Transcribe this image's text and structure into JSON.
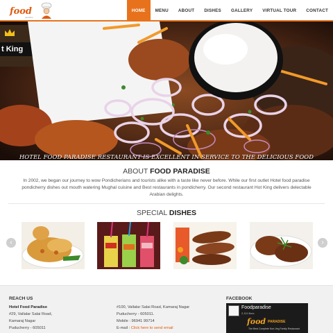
{
  "header": {
    "logo_text": "food",
    "logo_sub": "paradise",
    "nav": [
      "HOME",
      "MENU",
      "ABOUT",
      "DISHES",
      "GALLERY",
      "VIRTUAL TOUR",
      "CONTACT"
    ],
    "active_index": 0
  },
  "hero": {
    "sign_text": "t King",
    "caption": "HOTEL FOOD PARADISE RESTAURANT IS EXCELLENT IN SERVICE TO THE DELICIOUS FOOD"
  },
  "about": {
    "title_prefix": "ABOUT ",
    "title_bold": "FOOD PARADISE",
    "text": "In 2002, we began our journey to wow Pondicherians and tourists alike with a taste like never before. While our first outlet Hotel food paradise pondicherry dishes out mouth watering Mughal cuisine and Best restaurants in pondicherry. Our second restaurant Hot King delivers delectable Arabian delights."
  },
  "special": {
    "title_prefix": "SPECIAL ",
    "title_bold": "DISHES",
    "prev_icon": "‹",
    "next_icon": "›",
    "dishes": [
      "biryani",
      "juices",
      "kebab",
      "grill"
    ]
  },
  "footer": {
    "reach_title": "REACH US",
    "col1": [
      "Hotel Food Paradise",
      "#29, Vallalar Salai Road,",
      "Kamaraj Nagar",
      "Puducherry - 605011"
    ],
    "col2": [
      "#100, Vallalar Salai Road, Kamaraj Nagar",
      "Puducherry - 605011.",
      "Mobile : 96941 99714"
    ],
    "email_label": "E-mail : ",
    "email_link": "Click here to send email",
    "facebook_title": "FACEBOOK",
    "fb_name": "Foodparadise",
    "fb_likes": "2,111 likes",
    "fb_logo": "food",
    "fb_logo2": "PARADISE",
    "fb_tag": "The Best Complete Non-Veg Family Restaurant"
  },
  "colors": {
    "accent": "#e8721c",
    "link": "#e05a10"
  }
}
